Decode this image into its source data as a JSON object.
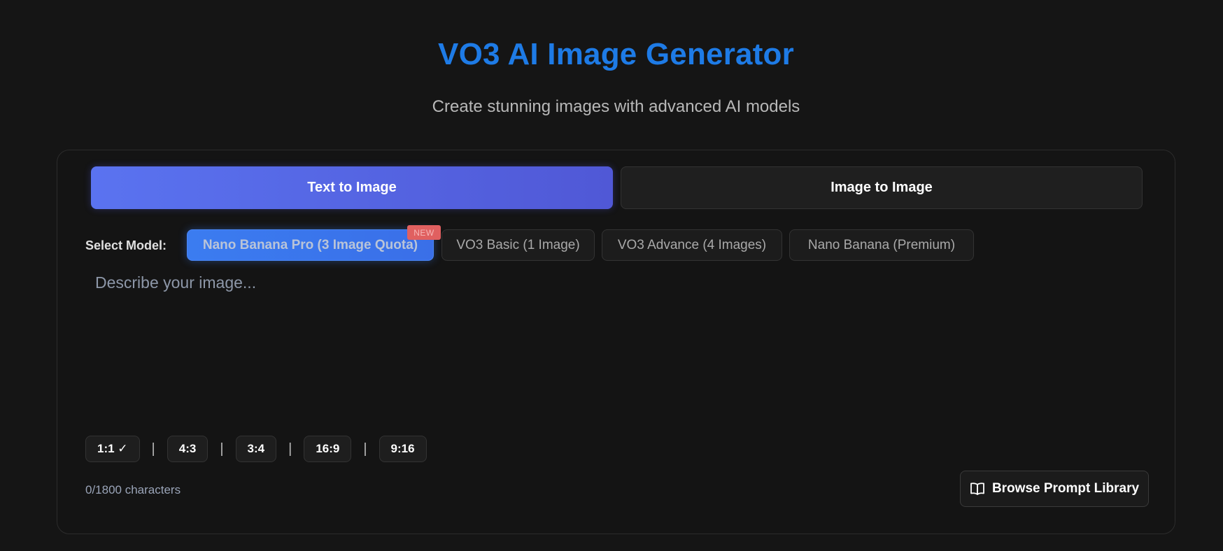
{
  "header": {
    "title": "VO3 AI Image Generator",
    "subtitle": "Create stunning images with advanced AI models"
  },
  "tabs": [
    {
      "label": "Text to Image",
      "active": true
    },
    {
      "label": "Image to Image",
      "active": false
    }
  ],
  "models": {
    "label": "Select Model:",
    "options": [
      {
        "label": "Nano Banana Pro (3 Image Quota)",
        "selected": true,
        "badge": "NEW"
      },
      {
        "label": "VO3 Basic (1 Image)",
        "selected": false
      },
      {
        "label": "VO3 Advance (4 Images)",
        "selected": false
      },
      {
        "label": "Nano Banana (Premium)",
        "selected": false
      }
    ]
  },
  "prompt": {
    "placeholder": "Describe your image...",
    "value": ""
  },
  "aspect_ratios": {
    "separator": "|",
    "options": [
      {
        "label": "1:1 ✓",
        "selected": true
      },
      {
        "label": "4:3",
        "selected": false
      },
      {
        "label": "3:4",
        "selected": false
      },
      {
        "label": "16:9",
        "selected": false
      },
      {
        "label": "9:16",
        "selected": false
      }
    ]
  },
  "char_count": "0/1800 characters",
  "library_button": {
    "label": "Browse Prompt Library",
    "icon": "book-icon"
  },
  "colors": {
    "accent": "#1e7be6",
    "tab_active": "#5a73f0",
    "model_selected": "#3b7cf0",
    "badge": "#e06060",
    "background": "#151515"
  }
}
